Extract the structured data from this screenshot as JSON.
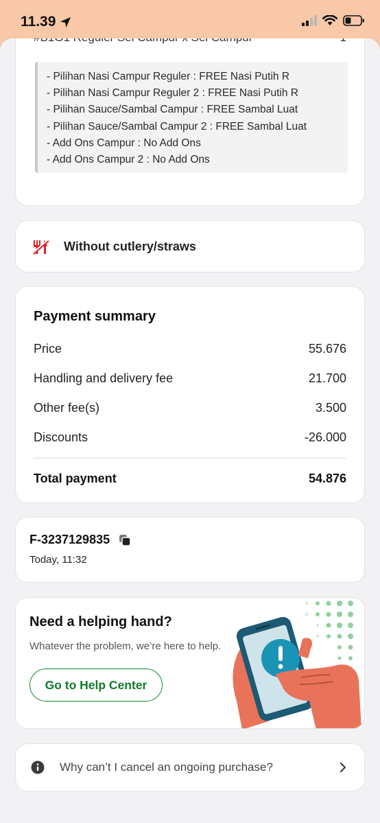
{
  "status_bar": {
    "time": "11.39"
  },
  "order_item": {
    "name": "#B1G1 Reguler Sei Campur x Sei Campur",
    "qty": "1",
    "notes": [
      "- Pilihan Nasi Campur Reguler : FREE Nasi Putih R",
      "- Pilihan Nasi Campur Reguler 2 : FREE Nasi Putih R",
      "- Pilihan Sauce/Sambal Campur : FREE Sambal Luat",
      "- Pilihan Sauce/Sambal Campur 2 : FREE Sambal Luat",
      "- Add Ons Campur : No Add Ons",
      "- Add Ons Campur 2 : No Add Ons"
    ]
  },
  "cutlery": {
    "label": "Without cutlery/straws",
    "icon": "no-cutlery-icon",
    "color": "#e02027"
  },
  "payment_summary": {
    "title": "Payment summary",
    "rows": [
      {
        "label": "Price",
        "value": "55.676"
      },
      {
        "label": "Handling and delivery fee",
        "value": "21.700"
      },
      {
        "label": "Other fee(s)",
        "value": "3.500"
      },
      {
        "label": "Discounts",
        "value": "-26.000"
      }
    ],
    "total_label": "Total payment",
    "total_value": "54.876"
  },
  "order_info": {
    "id": "F-3237129835",
    "time": "Today, 11:32"
  },
  "help": {
    "title": "Need a helping hand?",
    "subtitle": "Whatever the problem, we’re here to help.",
    "button": "Go to Help Center",
    "accent": "#0f8a2e"
  },
  "faq": {
    "question": "Why can’t I cancel an ongoing purchase?"
  }
}
